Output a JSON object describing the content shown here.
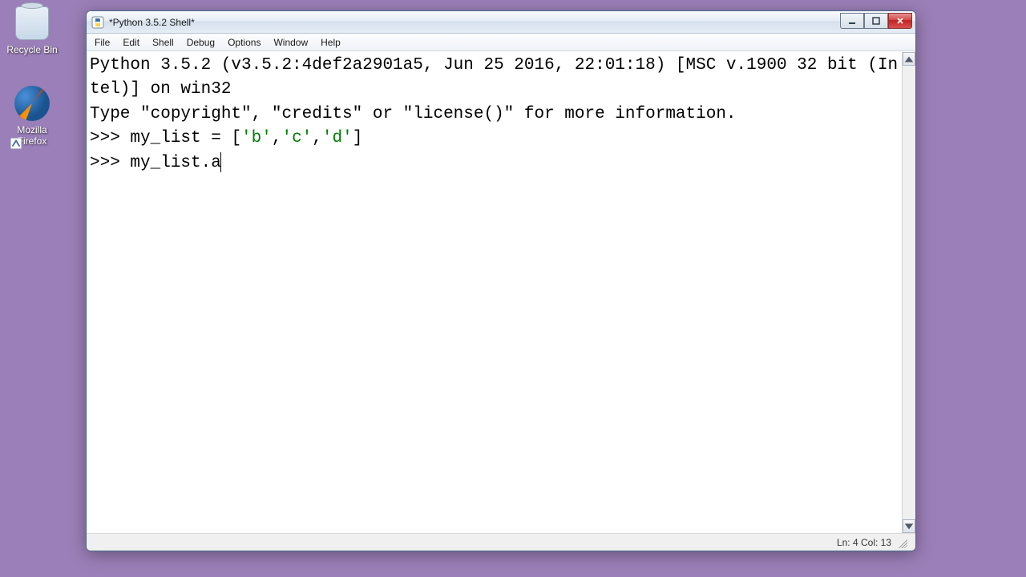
{
  "desktop": {
    "recycle_label": "Recycle Bin",
    "firefox_label": "Mozilla Firefox"
  },
  "window": {
    "title": "*Python 3.5.2 Shell*"
  },
  "menu": {
    "file": "File",
    "edit": "Edit",
    "shell": "Shell",
    "debug": "Debug",
    "options": "Options",
    "window": "Window",
    "help": "Help"
  },
  "shell": {
    "banner_line1": "Python 3.5.2 (v3.5.2:4def2a2901a5, Jun 25 2016, 22:01:18) [MSC v.1900 32 bit (Intel)] on win32",
    "banner_line2": "Type \"copyright\", \"credits\" or \"license()\" for more information.",
    "prompt": ">>> ",
    "line1_pre": "my_list = [",
    "line1_s1": "'b'",
    "line1_c1": ",",
    "line1_s2": "'c'",
    "line1_c2": ",",
    "line1_s3": "'d'",
    "line1_post": "]",
    "line2": "my_list.a"
  },
  "status": {
    "pos": "Ln: 4  Col: 13"
  },
  "icons": {
    "minimize": "minimize-icon",
    "maximize": "maximize-icon",
    "close": "close-icon",
    "python": "python-icon",
    "scroll_up": "scroll-up-icon",
    "scroll_down": "scroll-down-icon"
  }
}
